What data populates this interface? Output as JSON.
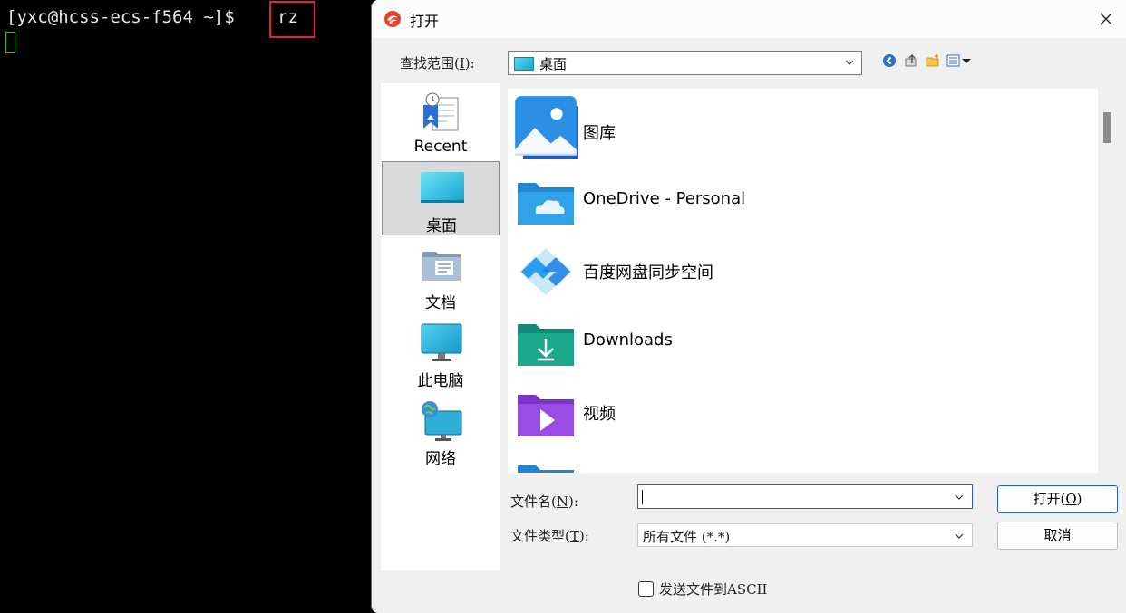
{
  "terminal": {
    "prompt": "[yxc@hcss-ecs-f564 ~]$",
    "command": "rz"
  },
  "dialog": {
    "title": "打开",
    "close_icon": "close-icon",
    "look_in": {
      "label_prefix": "查找范围(",
      "label_key": "I",
      "label_suffix": "):",
      "value": "桌面"
    },
    "toolbar": [
      "back-icon",
      "up-folder-icon",
      "new-folder-icon",
      "view-menu-icon"
    ],
    "places": [
      {
        "label": "Recent",
        "icon": "recent-icon",
        "selected": false
      },
      {
        "label": "桌面",
        "icon": "desktop-icon",
        "selected": true
      },
      {
        "label": "文档",
        "icon": "documents-icon",
        "selected": false
      },
      {
        "label": "此电脑",
        "icon": "this-pc-icon",
        "selected": false
      },
      {
        "label": "网络",
        "icon": "network-icon",
        "selected": false
      }
    ],
    "files": [
      {
        "name": "图库",
        "icon": "gallery-icon"
      },
      {
        "name": "OneDrive - Personal",
        "icon": "onedrive-folder-icon"
      },
      {
        "name": "百度网盘同步空间",
        "icon": "baidu-netdisk-icon"
      },
      {
        "name": "Downloads",
        "icon": "downloads-folder-icon"
      },
      {
        "name": "视频",
        "icon": "videos-folder-icon"
      }
    ],
    "file_name": {
      "label_prefix": "文件名(",
      "label_key": "N",
      "label_suffix": "):",
      "value": ""
    },
    "file_type": {
      "label_prefix": "文件类型(",
      "label_key": "T",
      "label_suffix": "):",
      "value": "所有文件 (*.*)"
    },
    "open_button": {
      "prefix": "打开(",
      "key": "O",
      "suffix": ")"
    },
    "cancel_button": "取消",
    "ascii_checkbox": {
      "label": "发送文件到ASCII",
      "checked": false
    }
  },
  "colors": {
    "terminal_bg": "#000000",
    "highlight_box": "#e0262b",
    "cursor": "#2ec82e",
    "accent": "#1f62b6"
  }
}
